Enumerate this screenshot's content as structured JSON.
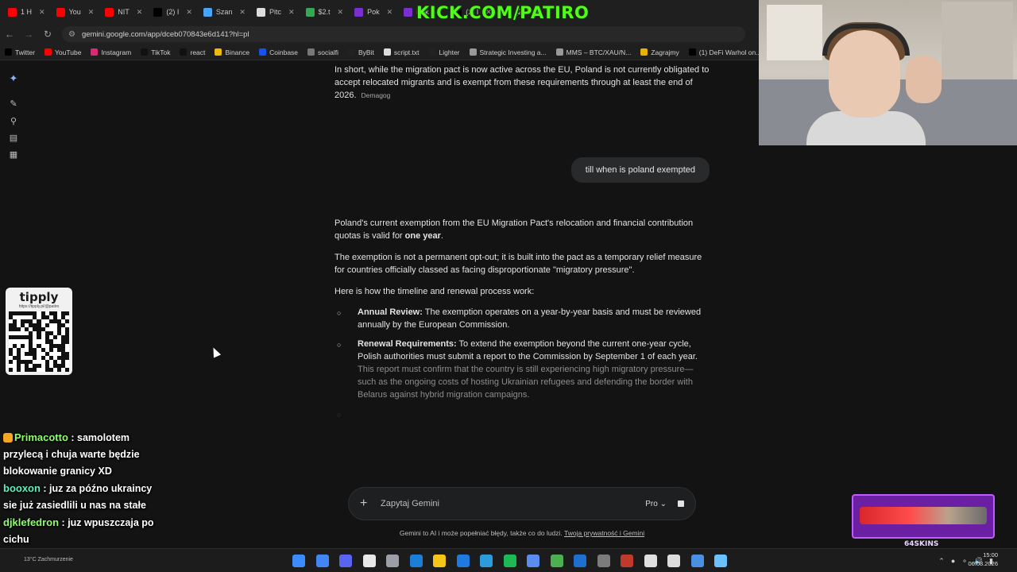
{
  "browser": {
    "tabs": [
      {
        "label": "1 H",
        "color": "#ff0000"
      },
      {
        "label": "You",
        "color": "#ff0000"
      },
      {
        "label": "NIT",
        "color": "#ff0000"
      },
      {
        "label": "(2) I",
        "color": "#000000"
      },
      {
        "label": "Szan",
        "color": "#4aa3ff"
      },
      {
        "label": "Pitc",
        "color": "#dddddd"
      },
      {
        "label": "$2.t",
        "color": "#34a853"
      },
      {
        "label": "Pok",
        "color": "#7b2fd0"
      },
      {
        "label": "Pok",
        "color": "#7b2fd0"
      },
      {
        "label": "(2) I",
        "color": "#000000"
      },
      {
        "label": "(2) I",
        "color": "#000000"
      }
    ],
    "url": "gemini.google.com/app/dceb070843e6d141?hl=pl",
    "bookmarks": [
      {
        "label": "Twitter",
        "color": "#000000"
      },
      {
        "label": "YouTube",
        "color": "#ff0000"
      },
      {
        "label": "Instagram",
        "color": "#d62976"
      },
      {
        "label": "TikTok",
        "color": "#111111"
      },
      {
        "label": "react",
        "color": "#111111"
      },
      {
        "label": "Binance",
        "color": "#f0b90b"
      },
      {
        "label": "Coinbase",
        "color": "#1652f0"
      },
      {
        "label": "socialfi",
        "color": "#777777"
      },
      {
        "label": "ByBit",
        "color": "#222222"
      },
      {
        "label": "script.txt",
        "color": "#dddddd"
      },
      {
        "label": "Lighter",
        "color": "#222222"
      },
      {
        "label": "Strategic Investing a...",
        "color": "#999999"
      },
      {
        "label": "MMS – BTC/XAU/N...",
        "color": "#999999"
      },
      {
        "label": "Zagrajmy",
        "color": "#e8b000"
      },
      {
        "label": "(1) DeFi Warhol on...",
        "color": "#000000"
      }
    ]
  },
  "overlay_banner": "KICK.COM/PATIRO",
  "chat": {
    "prev_paragraph": "In short, while the migration pact is now active across the EU, Poland is not currently obligated to accept relocated migrants and is exempt from these requirements through at least the end of 2026.",
    "prev_source": "Demagog",
    "user_message": "till when is poland exempted",
    "response": {
      "p1_a": "Poland's current exemption from the EU Migration Pact's relocation and financial contribution quotas is valid for ",
      "p1_bold": "one year",
      "p1_b": ".",
      "p2": "The exemption is not a permanent opt-out; it is built into the pact as a temporary relief measure for countries officially classed as facing disproportionate \"migratory pressure\".",
      "p3": "Here is how the timeline and renewal process work:",
      "bullets": [
        {
          "title": "Annual Review:",
          "text": " The exemption operates on a year-by-year basis and must be reviewed annually by the European Commission."
        },
        {
          "title": "Renewal Requirements:",
          "text": " To extend the exemption beyond the current one-year cycle, Polish authorities must submit a report to the Commission by September 1 of each year.",
          "faded": "This report must confirm that the country is still experiencing high migratory pressure—such as the ongoing costs of hosting Ukrainian refugees and defending the border with Belarus against hybrid migration campaigns."
        }
      ]
    }
  },
  "input": {
    "placeholder": "Zapytaj Gemini",
    "model": "Pro"
  },
  "disclaimer": {
    "text": "Gemini to AI i może popełniać błędy, także co do ludzi. ",
    "link": "Twoja prywatność i Gemini"
  },
  "tipply": {
    "title": "tipply",
    "url": "https://tipply.pl/@patiro"
  },
  "stream_chat": [
    {
      "user": "Primacotto",
      "color": "#8dff6a",
      "text": "samolotem przylecą i chuja warte będzie blokowanie granicy XD"
    },
    {
      "user": "booxon",
      "color": "#5ef0c0",
      "text": "juz za późno ukraincy sie już zasiedlili u nas na stałe"
    },
    {
      "user": "djklefedron",
      "color": "#8dff6a",
      "text": "juz wpuszczaja po cichu"
    }
  ],
  "skins_widget": {
    "label": "64SKINS"
  },
  "taskbar": {
    "weather": "13°C",
    "weather_desc": "Zachmurzenie",
    "time": "15:00",
    "date": "06.08.2026"
  }
}
